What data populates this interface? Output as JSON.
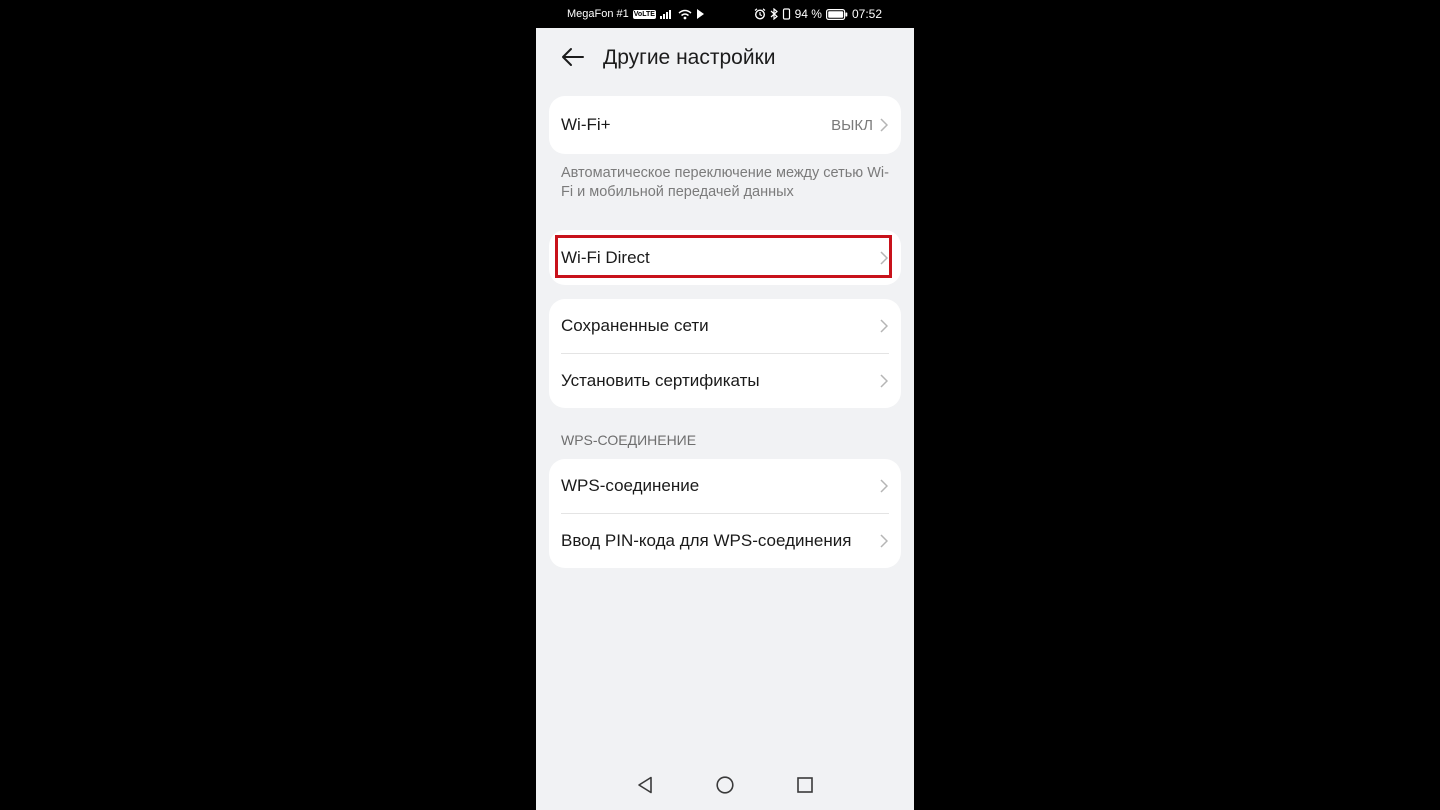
{
  "status_bar": {
    "carrier": "MegaFon #1",
    "network_badge": "VoLTE",
    "battery": "94 %",
    "time": "07:52",
    "icons": [
      "signal-icon",
      "wifi-icon",
      "play-icon",
      "alarm-icon",
      "bluetooth-icon",
      "vibrate-icon",
      "battery-icon"
    ]
  },
  "header": {
    "title": "Другие настройки",
    "back_icon": "arrow-left-icon"
  },
  "wifi_plus": {
    "label": "Wi-Fi+",
    "value": "ВЫКЛ",
    "description": "Автоматическое переключение между сетью Wi-Fi и мобильной передачей данных"
  },
  "wifi_direct": {
    "label": "Wi-Fi Direct",
    "highlight_color": "#c8121b"
  },
  "networks": {
    "items": [
      {
        "label": "Сохраненные сети"
      },
      {
        "label": "Установить сертификаты"
      }
    ]
  },
  "wps": {
    "section_title": "WPS-СОЕДИНЕНИЕ",
    "items": [
      {
        "label": "WPS-соединение"
      },
      {
        "label": "Ввод PIN-кода для WPS-соединения"
      }
    ]
  },
  "nav_bar": {
    "icons": [
      "nav-back-icon",
      "nav-home-icon",
      "nav-recents-icon"
    ]
  },
  "colors": {
    "background": "#f1f2f4",
    "card": "#ffffff",
    "primary_text": "#1a1a1a",
    "secondary_text": "#7b7b7b",
    "highlight": "#c8121b"
  }
}
